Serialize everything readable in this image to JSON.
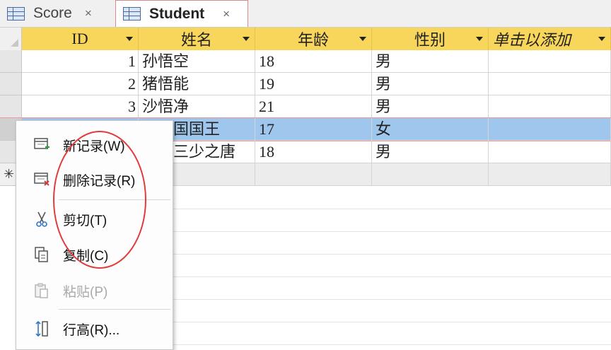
{
  "tabs": [
    {
      "label": "Score",
      "active": false,
      "close": "×"
    },
    {
      "label": "Student",
      "active": true,
      "close": "×"
    }
  ],
  "table": {
    "columns": [
      "ID",
      "姓名",
      "年龄",
      "性别",
      "单击以添加"
    ],
    "rows": [
      {
        "id": "1",
        "name": "孙悟空",
        "age": "18",
        "gender": "男"
      },
      {
        "id": "2",
        "name": "猪悟能",
        "age": "19",
        "gender": "男"
      },
      {
        "id": "3",
        "name": "沙悟净",
        "age": "21",
        "gender": "男"
      },
      {
        "id": "",
        "name": "女儿国国王",
        "age": "17",
        "gender": "女"
      },
      {
        "id": "",
        "name": "御家三少之唐",
        "age": "18",
        "gender": "男"
      }
    ],
    "new_row_marker": "✳"
  },
  "context_menu": {
    "items": [
      {
        "label": "新记录(W)",
        "icon": "new-record-icon",
        "enabled": true
      },
      {
        "label": "删除记录(R)",
        "icon": "delete-record-icon",
        "enabled": true
      },
      {
        "label": "剪切(T)",
        "icon": "scissors-icon",
        "enabled": true
      },
      {
        "label": "复制(C)",
        "icon": "copy-icon",
        "enabled": true
      },
      {
        "label": "粘贴(P)",
        "icon": "paste-icon",
        "enabled": false
      },
      {
        "label": "行高(R)...",
        "icon": "row-height-icon",
        "enabled": true
      }
    ]
  },
  "colors": {
    "header_bg": "#f8d65c",
    "selected_row": "#9fc6ec",
    "annotation_circle": "#e03c3c"
  }
}
